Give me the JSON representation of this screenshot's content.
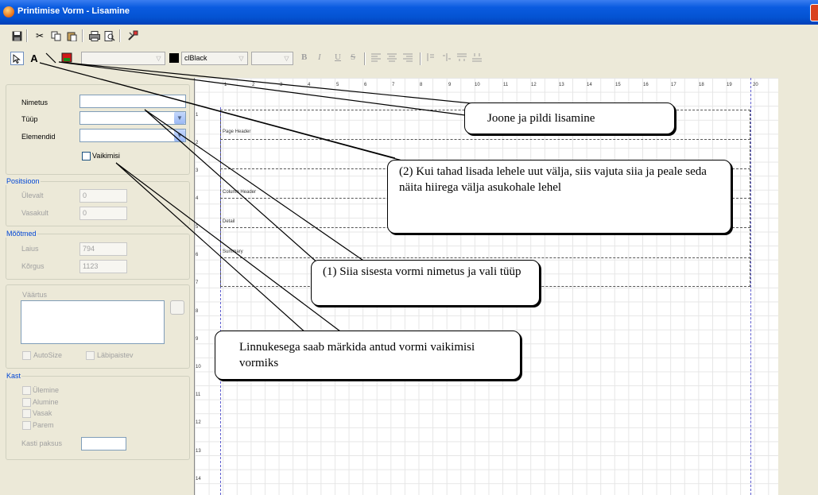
{
  "window": {
    "title": "Printimise Vorm - Lisamine"
  },
  "toolbar2": {
    "color_value": "clBlack",
    "format_bold": "B",
    "format_italic": "I",
    "format_underline": "U",
    "format_strike": "S"
  },
  "form": {
    "nimetus_label": "Nimetus",
    "tyyp_label": "Tüüp",
    "elemendid_label": "Elemendid",
    "vaikimisi_label": "Vaikimisi",
    "positsioon_title": "Positsioon",
    "ulevalt_label": "Ülevalt",
    "ulevalt_value": "0",
    "vasakult_label": "Vasakult",
    "vasakult_value": "0",
    "mootmed_title": "Mõõtmed",
    "laius_label": "Laius",
    "laius_value": "794",
    "korgus_label": "Kõrgus",
    "korgus_value": "1123",
    "vaartus_title": "Väärtus",
    "autosize_label": "AutoSize",
    "labipaistev_label": "Läbipaistev",
    "kast_title": "Kast",
    "ulemine_label": "Ülemine",
    "alumine_label": "Alumine",
    "vasak_label": "Vasak",
    "parem_label": "Parem",
    "kasti_paksus_label": "Kasti paksus"
  },
  "ruler": {
    "top": [
      "1",
      "2",
      "3",
      "4",
      "5",
      "6",
      "7",
      "8",
      "9",
      "10",
      "11",
      "12",
      "13",
      "14",
      "15",
      "16",
      "17",
      "18",
      "19",
      "20"
    ],
    "left": [
      "1",
      "2",
      "3",
      "4",
      "5",
      "6",
      "7",
      "8",
      "9",
      "10",
      "11",
      "12",
      "13",
      "14"
    ]
  },
  "bands": {
    "page_header": "Page Header",
    "column_header": "Column Header",
    "detail": "Detail",
    "summary": "Summary"
  },
  "callouts": {
    "c_lines": "Joone ja pildi lisamine",
    "c_field": "(2) Kui tahad lisada lehele uut välja, siis vajuta siia ja peale seda näita hiirega välja asukohale lehel",
    "c_name": "(1) Siia sisesta vormi nimetus ja vali tüüp",
    "c_default": "Linnukesega saab märkida antud vormi vaikimisi vormiks"
  }
}
